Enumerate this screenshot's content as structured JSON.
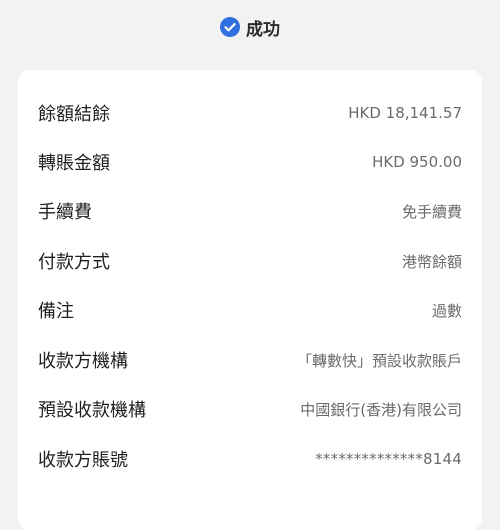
{
  "header": {
    "status_text": "成功",
    "status_icon": "check-circle-icon",
    "accent": "#2f6fe0"
  },
  "details": [
    {
      "label": "餘額結餘",
      "value": "HKD 18,141.57"
    },
    {
      "label": "轉賬金額",
      "value": "HKD 950.00"
    },
    {
      "label": "手續費",
      "value": "免手續費"
    },
    {
      "label": "付款方式",
      "value": "港幣餘額"
    },
    {
      "label": "備注",
      "value": "過數"
    },
    {
      "label": "收款方機構",
      "value": "「轉數快」預設收款賬戶"
    },
    {
      "label": "預設收款機構",
      "value": "中國銀行(香港)有限公司"
    },
    {
      "label": "收款方賬號",
      "value": "**************8144"
    }
  ]
}
